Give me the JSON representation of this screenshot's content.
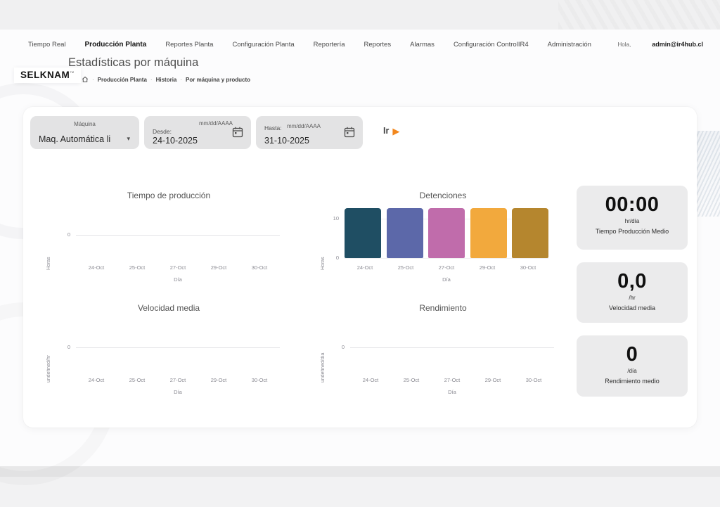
{
  "nav": {
    "items": [
      {
        "label": "Tiempo Real",
        "active": false
      },
      {
        "label": "Producción Planta",
        "active": true
      },
      {
        "label": "Reportes Planta",
        "active": false
      },
      {
        "label": "Configuración Planta",
        "active": false
      },
      {
        "label": "Reportería",
        "active": false
      },
      {
        "label": "Reportes",
        "active": false
      },
      {
        "label": "Alarmas",
        "active": false
      },
      {
        "label": "Configuración ControlIR4",
        "active": false
      },
      {
        "label": "Administración",
        "active": false
      }
    ],
    "greeting": "Hola,",
    "user": "admin@ir4hub.cl"
  },
  "header": {
    "logo": "SELKNAM",
    "logo_mark": "™",
    "title": "Estadísticas por máquina",
    "crumb_sep": "·",
    "breadcrumb": [
      "Producción Planta",
      "Historia",
      "Por máquina y producto"
    ]
  },
  "filters": {
    "machine": {
      "label": "Máquina",
      "value": "Maq. Automática li"
    },
    "from": {
      "label": "Desde:",
      "placeholder": "mm/dd/AAAA",
      "value": "24-10-2025"
    },
    "to": {
      "label": "Hasta:",
      "placeholder": "mm/dd/AAAA",
      "value": "31-10-2025"
    },
    "go_label": "Ir"
  },
  "icons": {
    "caret_down": "▾",
    "play": "▶"
  },
  "chart_data": [
    {
      "type": "line",
      "title": "Tiempo de producción",
      "xlabel": "Día",
      "ylabel": "Horas",
      "x": [
        "24-Oct",
        "25-Oct",
        "27-Oct",
        "29-Oct",
        "30-Oct"
      ],
      "values": [
        0,
        0,
        0,
        0,
        0
      ],
      "y_ticks": [
        "0"
      ],
      "grid": false,
      "legend": "none"
    },
    {
      "type": "bar",
      "title": "Detenciones",
      "xlabel": "Día",
      "ylabel": "Horas",
      "categories": [
        "24-Oct",
        "25-Oct",
        "27-Oct",
        "29-Oct",
        "30-Oct"
      ],
      "values": [
        12.5,
        12.5,
        12.5,
        12.5,
        12.5
      ],
      "ylim": [
        0,
        14
      ],
      "y_ticks": [
        "0",
        "10"
      ],
      "colors": [
        "#1f4e63",
        "#5c68a9",
        "#c06cab",
        "#f2a93d",
        "#b5862e"
      ],
      "grid": true,
      "legend": "none"
    },
    {
      "type": "line",
      "title": "Velocidad media",
      "xlabel": "Día",
      "ylabel": "undefined/hr",
      "x": [
        "24-Oct",
        "25-Oct",
        "27-Oct",
        "29-Oct",
        "30-Oct"
      ],
      "values": [
        0,
        0,
        0,
        0,
        0
      ],
      "y_ticks": [
        "0"
      ],
      "grid": false,
      "legend": "none"
    },
    {
      "type": "line",
      "title": "Rendimiento",
      "xlabel": "Día",
      "ylabel": "undefined/día",
      "x": [
        "24-Oct",
        "25-Oct",
        "27-Oct",
        "29-Oct",
        "30-Oct"
      ],
      "values": [
        0,
        0,
        0,
        0,
        0
      ],
      "y_ticks": [
        "0"
      ],
      "grid": false,
      "legend": "none"
    }
  ],
  "kpis": [
    {
      "value": "00:00",
      "unit": "hr/día",
      "label": "Tiempo Producción Medio"
    },
    {
      "value": "0,0",
      "unit": "/hr",
      "label": "Velocidad media"
    },
    {
      "value": "0",
      "unit": "/día",
      "label": "Rendimiento medio"
    }
  ],
  "colors": {
    "accent_orange": "#f2871d",
    "chip_bg": "#e3e3e4",
    "kpi_bg": "#ebebec"
  }
}
